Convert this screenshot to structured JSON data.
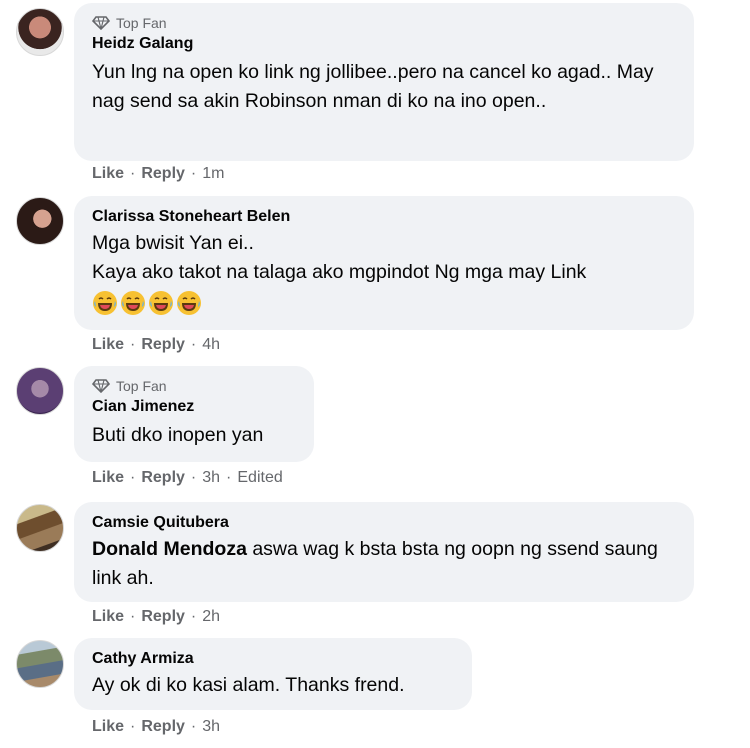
{
  "comments": [
    {
      "badge": "Top Fan",
      "author": "Heidz Galang",
      "text": "Yun lng na open ko link ng jollibee..pero na cancel ko agad.. May nag send sa akin Robinson nman di ko na ino open..",
      "like": "Like",
      "reply": "Reply",
      "time": "1m"
    },
    {
      "author": "Clarissa Stoneheart Belen",
      "text": "Mga bwisit Yan ei..\nKaya ako takot na talaga ako mgpindot Ng mga may Link",
      "emoji": [
        "laughing-crying-emoji",
        "laughing-crying-emoji",
        "laughing-crying-emoji",
        "laughing-crying-emoji"
      ],
      "like": "Like",
      "reply": "Reply",
      "time": "4h"
    },
    {
      "badge": "Top Fan",
      "author": "Cian Jimenez",
      "text": "Buti dko inopen yan",
      "like": "Like",
      "reply": "Reply",
      "time": "3h",
      "edited": "Edited"
    },
    {
      "author": "Camsie Quitubera",
      "mention": "Donald Mendoza",
      "text": " aswa wag k bsta bsta ng oopn ng ssend saung link ah.",
      "like": "Like",
      "reply": "Reply",
      "time": "2h"
    },
    {
      "author": "Cathy Armiza",
      "text": "Ay ok di ko kasi alam. Thanks frend.",
      "like": "Like",
      "reply": "Reply",
      "time": "3h"
    }
  ],
  "colors": {
    "bubble": "#f0f2f5",
    "meta_text": "#65676b",
    "text": "#050505",
    "emoji_face": "#f7c132"
  },
  "separator": "·"
}
